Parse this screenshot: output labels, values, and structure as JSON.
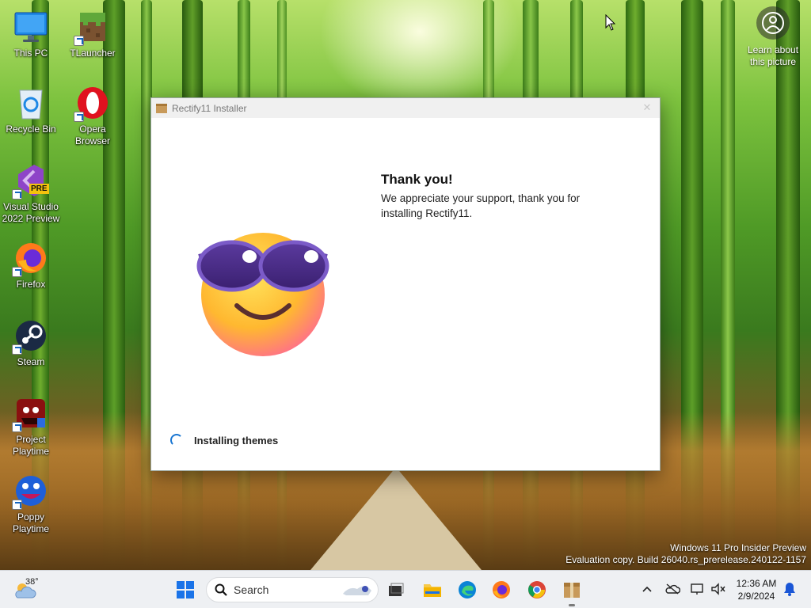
{
  "desktop": {
    "icons": [
      {
        "label_line1": "This PC",
        "label_line2": ""
      },
      {
        "label_line1": "TLauncher",
        "label_line2": ""
      },
      {
        "label_line1": "Recycle Bin",
        "label_line2": ""
      },
      {
        "label_line1": "Opera",
        "label_line2": "Browser"
      },
      {
        "label_line1": "Visual Studio",
        "label_line2": "2022 Preview"
      },
      {
        "label_line1": "Firefox",
        "label_line2": ""
      },
      {
        "label_line1": "Steam",
        "label_line2": ""
      },
      {
        "label_line1": "Project",
        "label_line2": "Playtime"
      },
      {
        "label_line1": "Poppy",
        "label_line2": "Playtime"
      }
    ],
    "vs_badge": "PRE",
    "learn_line1": "Learn about",
    "learn_line2": "this picture",
    "watermark_line1": "Windows 11 Pro Insider Preview",
    "watermark_line2": "Evaluation copy. Build 26040.rs_prerelease.240122-1157"
  },
  "installer": {
    "title": "Rectify11 Installer",
    "heading": "Thank you!",
    "message": "We appreciate your support, thank you for installing Rectify11.",
    "status": "Installing themes",
    "emoji_icon": "smiling-face-with-sunglasses-icon",
    "close_glyph": "✕"
  },
  "taskbar": {
    "temperature": "38°",
    "search_placeholder": "Search",
    "time": "12:36 AM",
    "date": "2/9/2024",
    "apps": [
      "start-icon",
      "file-explorer-icon",
      "edge-icon",
      "firefox-icon",
      "chrome-icon",
      "rectify11-installer-icon"
    ]
  },
  "colors": {
    "accent": "#1976d2",
    "taskbar_bg": "#eef0f3"
  }
}
